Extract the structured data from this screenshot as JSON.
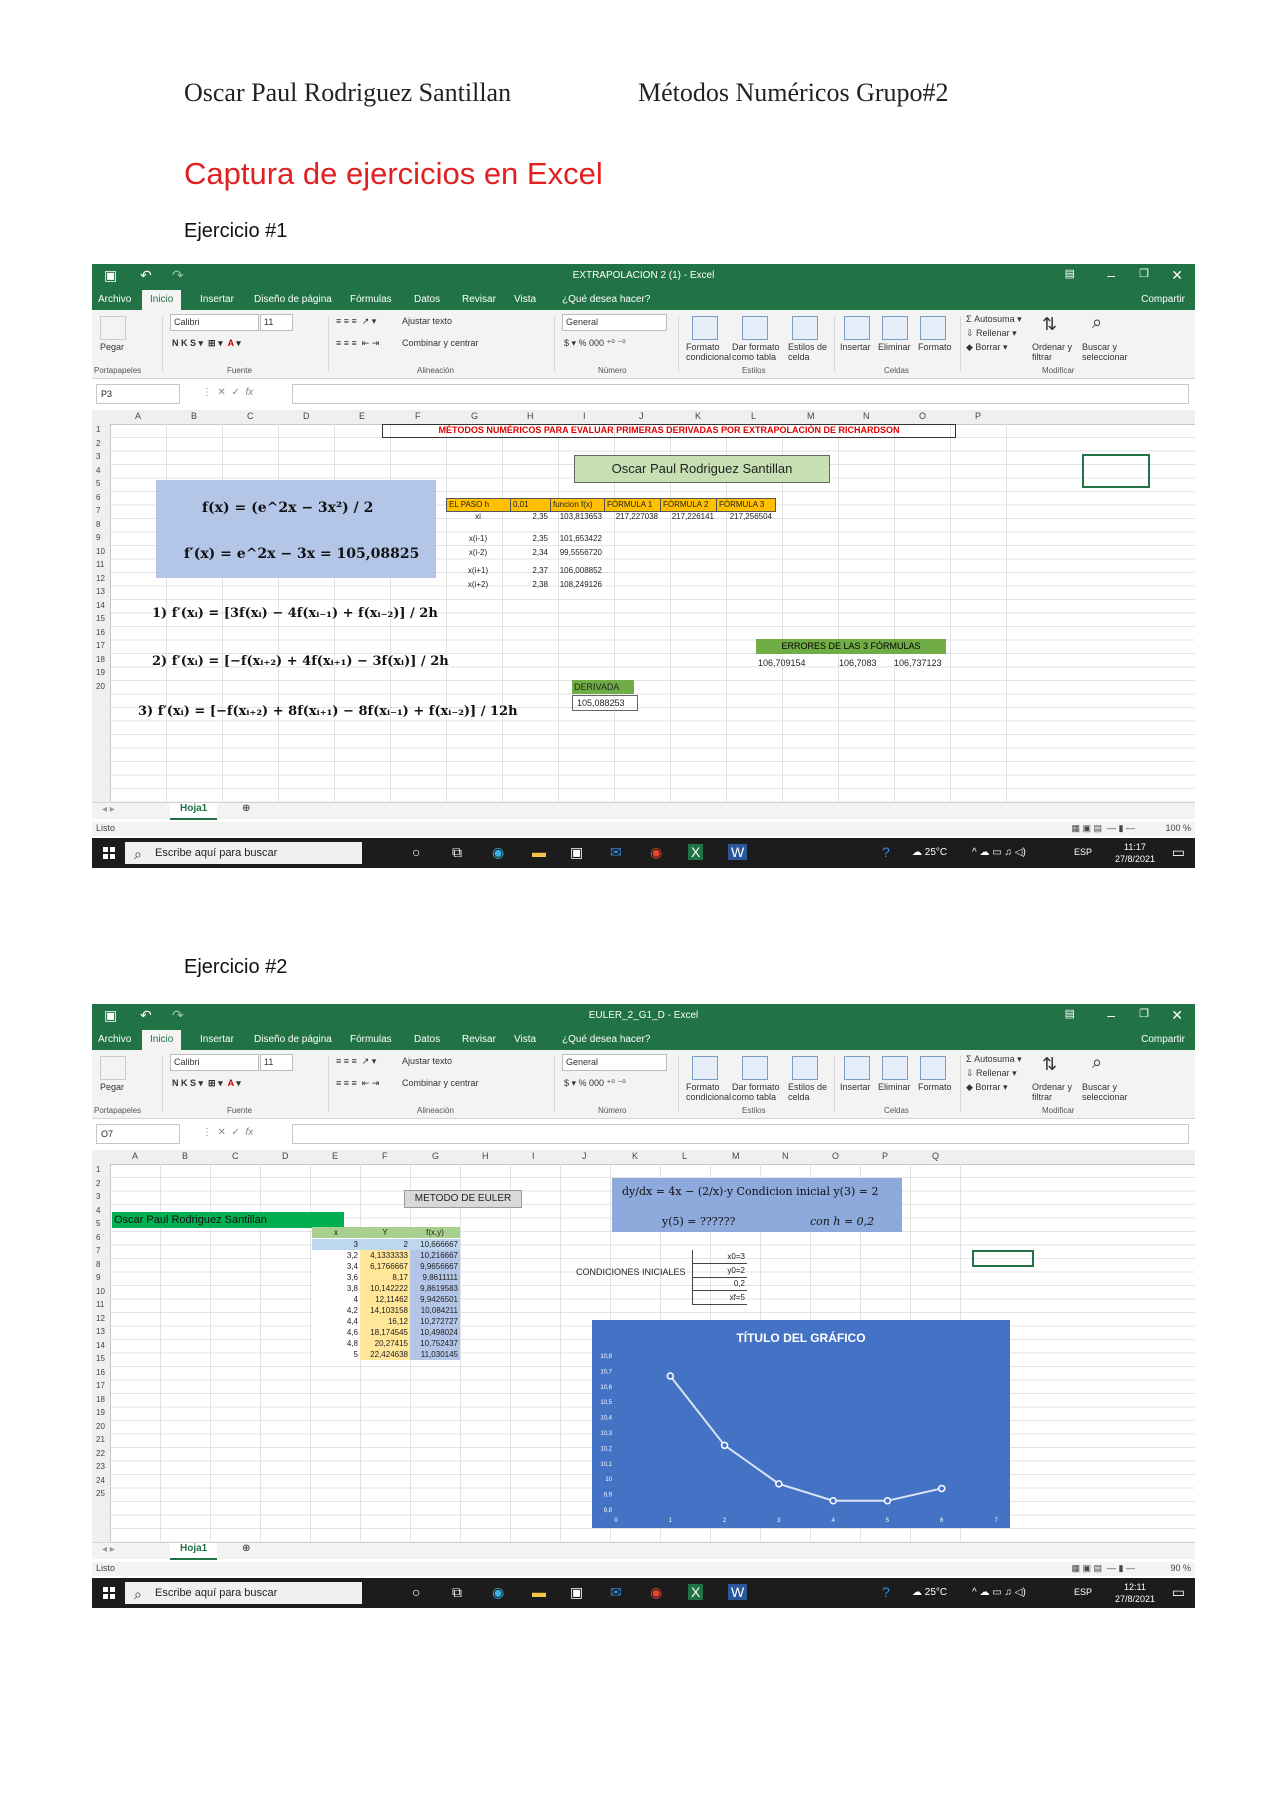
{
  "header": {
    "author": "Oscar Paul Rodriguez Santillan",
    "course": "Métodos Numéricos Grupo#2"
  },
  "title": "Captura de ejercicios en Excel",
  "ex1": {
    "heading": "Ejercicio #1",
    "window_title": "EXTRAPOLACION 2 (1) - Excel",
    "menu": [
      "Archivo",
      "Inicio",
      "Insertar",
      "Diseño de página",
      "Fórmulas",
      "Datos",
      "Revisar",
      "Vista",
      "¿Qué desea hacer?"
    ],
    "share": "Compartir",
    "ribbon": {
      "font": "Calibri",
      "size": "11",
      "ajustar": "Ajustar texto",
      "combinar": "Combinar y centrar",
      "general": "General",
      "groups": [
        "Portapapeles",
        "Fuente",
        "Alineación",
        "Número",
        "Estilos",
        "Celdas",
        "Modificar"
      ],
      "paste": "Pegar",
      "formato_cond": "Formato condicional",
      "dar_formato": "Dar formato como tabla",
      "estilos": "Estilos de celda",
      "insertar": "Insertar",
      "eliminar": "Eliminar",
      "formato": "Formato",
      "autosuma": "Autosuma",
      "rellenar": "Rellenar",
      "borrar": "Borrar",
      "ordenar": "Ordenar y filtrar",
      "buscar": "Buscar y seleccionar"
    },
    "namebox": "P3",
    "columns": [
      "A",
      "B",
      "C",
      "D",
      "E",
      "F",
      "G",
      "H",
      "I",
      "J",
      "K",
      "L",
      "M",
      "N",
      "O",
      "P"
    ],
    "rows": [
      "1",
      "2",
      "3",
      "4",
      "5",
      "6",
      "7",
      "8",
      "9",
      "10",
      "11",
      "12",
      "13",
      "14",
      "15",
      "16",
      "17",
      "18",
      "19",
      "20"
    ],
    "sheet_title": "MÉTODOS NUMÉRICOS PARA EVALUAR PRIMERAS DERIVADAS POR EXTRAPOLACIÓN DE RICHARDSON",
    "name_box_text": "Oscar Paul Rodriguez Santillan",
    "func_f": "f(x) = (e^2x − 3x²) / 2",
    "func_fp": "f′(x) = e^2x − 3x = 105,08825",
    "formula1": "1) f′(xᵢ) = [3f(xᵢ) − 4f(xᵢ₋₁) + f(xᵢ₋₂)] / 2h",
    "formula2": "2) f′(xᵢ) = [−f(xᵢ₊₂) + 4f(xᵢ₊₁) − 3f(xᵢ)] / 2h",
    "formula3": "3) f′(xᵢ) = [−f(xᵢ₊₂) + 8f(xᵢ₊₁) − 8f(xᵢ₋₁) + f(xᵢ₋₂)] / 12h",
    "table_header": [
      "EL PASO h",
      "0,01",
      "funcion f(x)",
      "FÓRMULA 1",
      "FÓRMULA 2",
      "FÓRMULA 3"
    ],
    "table_rows": [
      [
        "xi",
        "2,35",
        "103,813653",
        "217,227038",
        "217,226141",
        "217,256504"
      ],
      [
        "x(i-1)",
        "2,35",
        "101,653422",
        "",
        "",
        ""
      ],
      [
        "x(i-2)",
        "2,34",
        "99,5556720",
        "",
        "",
        ""
      ],
      [
        "x(i+1)",
        "2,37",
        "106,008852",
        "",
        "",
        ""
      ],
      [
        "x(i+2)",
        "2,38",
        "108,249126",
        "",
        "",
        ""
      ]
    ],
    "errors_label": "ERRORES DE LAS 3 FÓRMULAS",
    "errors": [
      "106,709154",
      "106,7083",
      "106,737123"
    ],
    "derivada_label": "DERIVADA",
    "derivada": "105,088253",
    "sheet_tab": "Hoja1",
    "status": "Listo",
    "zoom": "100 %",
    "search": "Escribe aquí para buscar",
    "temp": "25°C",
    "lang": "ESP",
    "time": "11:17",
    "date": "27/8/2021"
  },
  "ex2": {
    "heading": "Ejercicio #2",
    "window_title": "EULER_2_G1_D - Excel",
    "namebox": "O7",
    "columns": [
      "A",
      "B",
      "C",
      "D",
      "E",
      "F",
      "G",
      "H",
      "I",
      "J",
      "K",
      "L",
      "M",
      "N",
      "O",
      "P",
      "Q"
    ],
    "rows": [
      "1",
      "2",
      "3",
      "4",
      "5",
      "6",
      "7",
      "8",
      "9",
      "10",
      "11",
      "12",
      "13",
      "14",
      "15",
      "16",
      "17",
      "18",
      "19",
      "20",
      "21",
      "22",
      "23",
      "24",
      "25"
    ],
    "method_title": "METODO DE EULER",
    "name_cell": "Oscar Paul Rodriguez Santillan",
    "ode": "dy/dx = 4x − (2/x)·y   Condicion inicial y(3) = 2",
    "target": "y(5) = ??????",
    "step": "con h = 0,2",
    "cond_label": "CONDICIONES INICIALES",
    "conds": [
      "x0=3",
      "y0=2",
      "0,2",
      "xf=5"
    ],
    "table_header": [
      "x",
      "Y",
      "f(x,y)"
    ],
    "table_rows": [
      [
        "3",
        "2",
        "10,666667"
      ],
      [
        "3,2",
        "4,1333333",
        "10,216667"
      ],
      [
        "3,4",
        "6,1766667",
        "9,9656667"
      ],
      [
        "3,6",
        "8,17",
        "9,8611111"
      ],
      [
        "3,8",
        "10,142222",
        "9,8619583"
      ],
      [
        "4",
        "12,11462",
        "9,9426501"
      ],
      [
        "4,2",
        "14,103158",
        "10,084211"
      ],
      [
        "4,4",
        "16,12",
        "10,272727"
      ],
      [
        "4,6",
        "18,174545",
        "10,498024"
      ],
      [
        "4,8",
        "20,27415",
        "10,752437"
      ],
      [
        "5",
        "22,424638",
        "11,030145"
      ]
    ],
    "sheet_tab": "Hoja1",
    "status": "Listo",
    "zoom": "90 %",
    "search": "Escribe aquí para buscar",
    "temp": "25°C",
    "lang": "ESP",
    "time": "12:11",
    "date": "27/8/2021"
  },
  "chart_data": {
    "type": "line",
    "title": "TÍTULO DEL GRÁFICO",
    "x": [
      1,
      2,
      3,
      4,
      5,
      6
    ],
    "series": [
      {
        "values": [
          10.67,
          10.22,
          9.97,
          9.86,
          9.86,
          9.94
        ]
      }
    ],
    "xlim": [
      0,
      7
    ],
    "ylim": [
      9.8,
      10.8
    ],
    "xticks": [
      "0",
      "1",
      "2",
      "3",
      "4",
      "5",
      "6",
      "7"
    ],
    "yticks": [
      "9,8",
      "9,9",
      "10",
      "10,1",
      "10,2",
      "10,3",
      "10,4",
      "10,5",
      "10,6",
      "10,7",
      "10,8"
    ],
    "grid": false,
    "bg_color": "#4472c4",
    "line_color": "#dbe4f5"
  }
}
